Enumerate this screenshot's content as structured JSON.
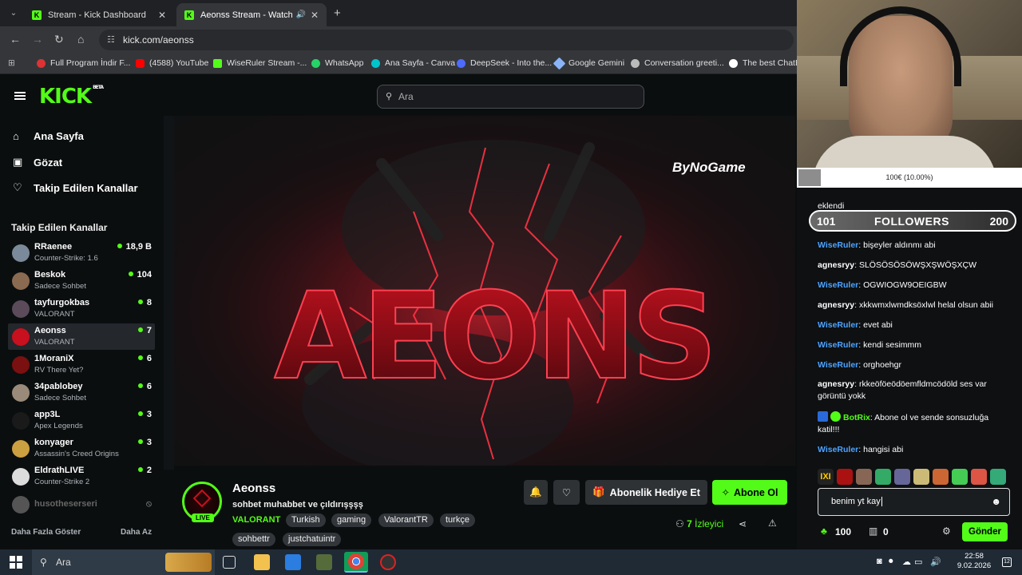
{
  "browser": {
    "tabs": [
      {
        "title": "Stream - Kick Dashboard"
      },
      {
        "title": "Aeonss Stream - Watch Live"
      }
    ],
    "url": "kick.com/aeonss",
    "bookmarks": [
      "Full Program İndir F...",
      "(4588) YouTube",
      "WiseRuler Stream -...",
      "WhatsApp",
      "Ana Sayfa - Canva",
      "DeepSeek - Into the...",
      "Google Gemini",
      "Conversation greeti...",
      "The best ChatBo"
    ]
  },
  "header": {
    "logo": "KICK",
    "logo_sup": "BETA",
    "search_placeholder": "Ara"
  },
  "sidebar": {
    "nav": [
      {
        "label": "Ana Sayfa",
        "icon": "home-icon"
      },
      {
        "label": "Gözat",
        "icon": "browse-icon"
      },
      {
        "label": "Takip Edilen Kanallar",
        "icon": "heart-icon"
      }
    ],
    "section_title": "Takip Edilen Kanallar",
    "channels": [
      {
        "name": "RRaenee",
        "game": "Counter-Strike: 1.6",
        "viewers": "18,9 B",
        "color": "#7a8a9a"
      },
      {
        "name": "Beskok",
        "game": "Sadece Sohbet",
        "viewers": "104",
        "color": "#8a6a50"
      },
      {
        "name": "tayfurgokbas",
        "game": "VALORANT",
        "viewers": "8",
        "color": "#5a4a5a"
      },
      {
        "name": "Aeonss",
        "game": "VALORANT",
        "viewers": "7",
        "color": "#c8101e"
      },
      {
        "name": "1MoraniX",
        "game": "RV There Yet?",
        "viewers": "6",
        "color": "#7a1010"
      },
      {
        "name": "34pablobey",
        "game": "Sadece Sohbet",
        "viewers": "6",
        "color": "#9a8a7a"
      },
      {
        "name": "app3L",
        "game": "Apex Legends",
        "viewers": "3",
        "color": "#1a1a1a"
      },
      {
        "name": "konyager",
        "game": "Assassin's Creed Origins",
        "viewers": "3",
        "color": "#caa040"
      },
      {
        "name": "EldrathLIVE",
        "game": "Counter-Strike 2",
        "viewers": "2",
        "color": "#dcdcdc"
      },
      {
        "name": "husotheserseri",
        "game": "",
        "viewers": "",
        "color": "#555"
      }
    ],
    "show_more": "Daha Fazla Göster",
    "show_less": "Daha Az"
  },
  "player": {
    "watermark": "ByNoGame",
    "art_text": "AEONS"
  },
  "stream": {
    "streamer": "Aeonss",
    "live_label": "LIVE",
    "title": "sohbet muhabbet ve çıldırışşşş",
    "category": "VALORANT",
    "tags": [
      "Turkish",
      "gaming",
      "ValorantTR",
      "turkçe",
      "sohbettr",
      "justchatuintr"
    ],
    "gift_label": "Abonelik Hediye Et",
    "subscribe_label": "Abone Ol",
    "viewers_count": "7",
    "viewers_label": "İzleyici"
  },
  "overlay": {
    "goal_text": "100€ (10.00%)",
    "goal_progress": 0.1,
    "followers_label": "FOLLOWERS",
    "followers_min": "101",
    "followers_max": "200"
  },
  "chat": {
    "added_line": "eklendi",
    "messages": [
      {
        "user": "WiseRuler",
        "text": ": bişeyler aldınmı abi",
        "kind": "wr"
      },
      {
        "user": "agnesryy",
        "text": ": SLÖSÖSÖSÖWŞXŞWÖŞXÇW",
        "kind": "ag"
      },
      {
        "user": "WiseRuler",
        "text": ": OGWIOGW9OEIGBW",
        "kind": "wr"
      },
      {
        "user": "agnesryy",
        "text": ": xkkwmxlwmdksöxlwl helal olsun abii",
        "kind": "ag"
      },
      {
        "user": "WiseRuler",
        "text": ": evet abi",
        "kind": "wr"
      },
      {
        "user": "WiseRuler",
        "text": ": kendi sesimmm",
        "kind": "wr"
      },
      {
        "user": "WiseRuler",
        "text": ": orghoehgr",
        "kind": "wr"
      },
      {
        "user": "agnesryy",
        "text": ": rkkeöföeödöemfldmcödöld ses var görüntü yokk",
        "kind": "ag"
      },
      {
        "user": "BotRix",
        "text": ": Abone ol ve sende sonsuzluğa katil!!!",
        "kind": "bt"
      },
      {
        "user": "WiseRuler",
        "text": ": hangisi abi",
        "kind": "wr"
      }
    ],
    "input_value": "benim yt kay",
    "points": "100",
    "drops": "0",
    "send_label": "Gönder"
  },
  "taskbar": {
    "search_placeholder": "Ara",
    "time": "22:58",
    "date": "9.02.2026",
    "notif_count": "12"
  }
}
